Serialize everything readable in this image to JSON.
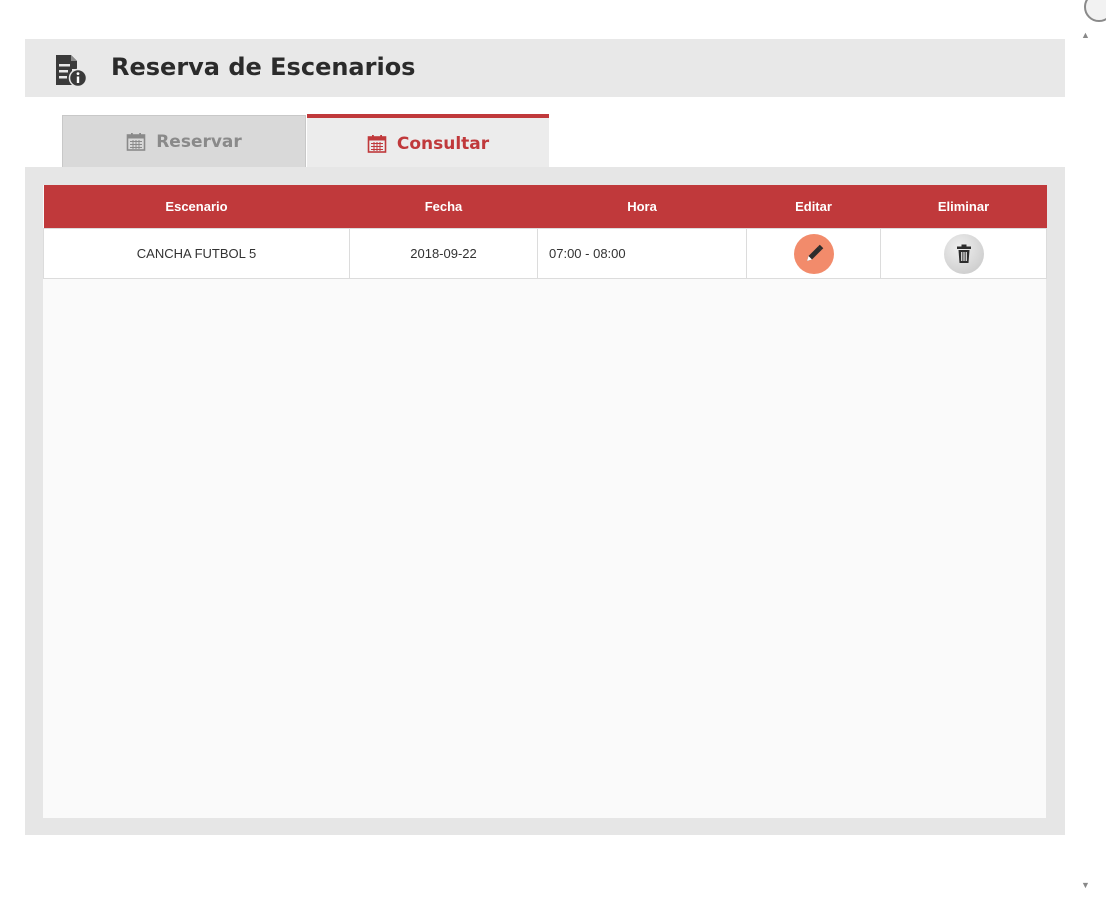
{
  "header": {
    "title": "Reserva de Escenarios",
    "icon": "document-info-icon"
  },
  "tabs": [
    {
      "label": "Reservar",
      "icon": "calendar-icon",
      "active": false
    },
    {
      "label": "Consultar",
      "icon": "calendar-icon",
      "active": true
    }
  ],
  "table": {
    "columns": [
      "Escenario",
      "Fecha",
      "Hora",
      "Editar",
      "Eliminar"
    ],
    "rows": [
      {
        "escenario": "CANCHA FUTBOL 5",
        "fecha": "2018-09-22",
        "hora": "07:00 - 08:00",
        "edit_icon": "pencil-icon",
        "delete_icon": "trash-icon"
      }
    ]
  },
  "colors": {
    "accent": "#c0393b",
    "edit_button": "#f28b6b",
    "panel": "#e6e6e6",
    "header_bg": "#e8e8e8"
  }
}
